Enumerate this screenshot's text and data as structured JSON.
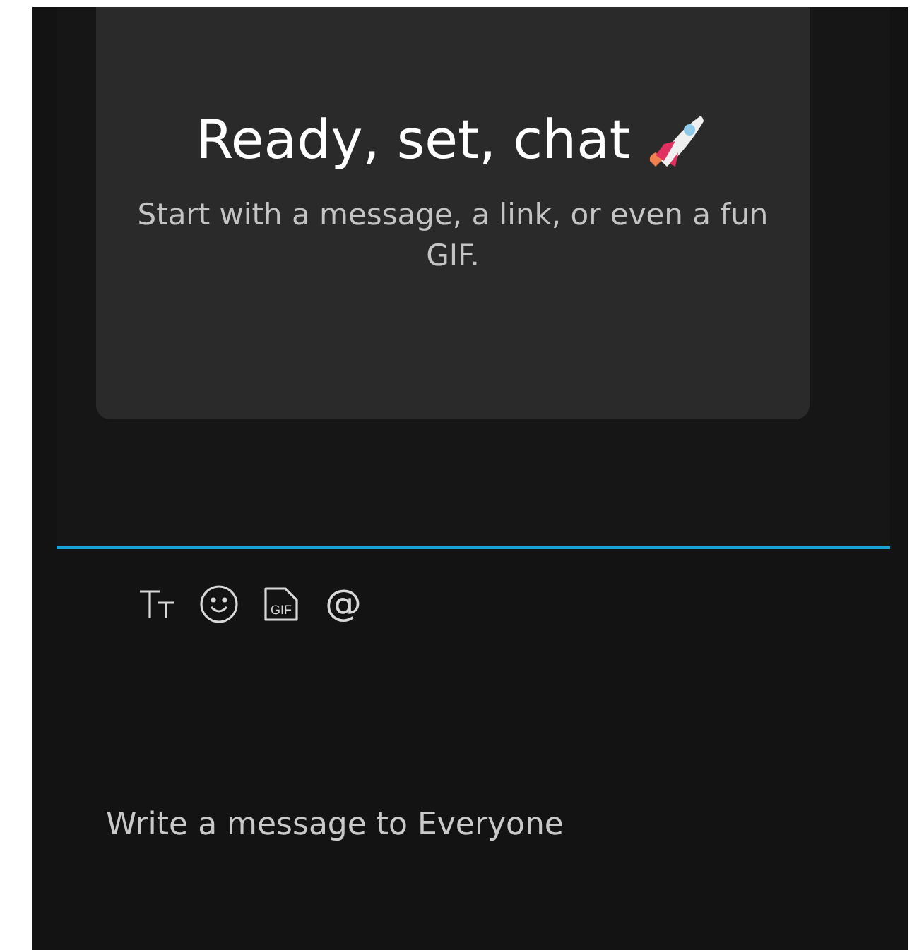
{
  "empty_state": {
    "title": "Ready, set, chat",
    "subtitle": "Start with a message, a link, or even a fun GIF."
  },
  "toolbar": [
    {
      "kind": "format"
    },
    {
      "kind": "emoji"
    },
    {
      "kind": "gif",
      "label": "GIF"
    },
    {
      "kind": "mention",
      "label": "@"
    }
  ],
  "compose": {
    "placeholder": "Write a message to Everyone"
  }
}
